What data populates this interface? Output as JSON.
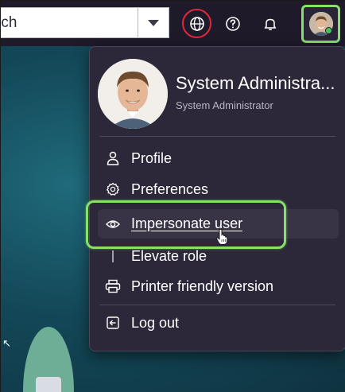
{
  "topbar": {
    "search_value": "rch",
    "icons": {
      "globe": "globe-icon",
      "help": "help-circle-icon",
      "bell": "bell-icon",
      "dropdown": "chevron-down-icon"
    }
  },
  "menu": {
    "user_name": "System Administra...",
    "user_role": "System Administrator",
    "items": [
      {
        "label": "Profile",
        "icon": "person-icon"
      },
      {
        "label": "Preferences",
        "icon": "gear-icon"
      },
      {
        "label": "Impersonate user",
        "icon": "eye-icon"
      },
      {
        "label": "Elevate role",
        "icon": "arrow-up-icon"
      },
      {
        "label": "Printer friendly version",
        "icon": "printer-icon"
      },
      {
        "label": "Log out",
        "icon": "logout-icon"
      }
    ]
  },
  "colors": {
    "highlight": "#86e06a",
    "globe_ring": "#e0283c",
    "menu_bg": "#2c2839",
    "status_online": "#4cc35a"
  }
}
